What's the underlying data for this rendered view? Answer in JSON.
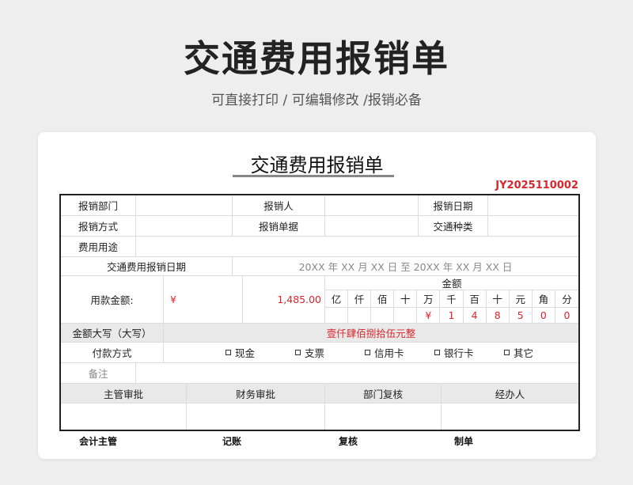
{
  "header": {
    "title": "交通费用报销单",
    "subtitle": "可直接打印 /  可编辑修改  /报销必备"
  },
  "form": {
    "title": "交通费用报销单",
    "doc_no": "JY2025110002",
    "labels": {
      "dept": "报销部门",
      "applicant": "报销人",
      "date": "报销日期",
      "method": "报销方式",
      "receipt": "报销单据",
      "transport_type": "交通种类",
      "purpose": "费用用途",
      "period": "交通费用报销日期",
      "amount": "用款金额:",
      "amount_header": "金额",
      "amount_upper": "金额大写（大写）",
      "pay_method": "付款方式",
      "note": "备注"
    },
    "period_text": "20XX  年  XX  月  XX  日    至    20XX  年  XX  月  XX  日",
    "currency": "¥",
    "amount_value": "1,485.00",
    "digit_units": [
      "亿",
      "仟",
      "佰",
      "十",
      "万",
      "千",
      "百",
      "十",
      "元",
      "角",
      "分"
    ],
    "digit_values": [
      "",
      "",
      "",
      "",
      "¥",
      "1",
      "4",
      "8",
      "5",
      "0",
      "0"
    ],
    "amount_upper_value": "壹仟肆佰捌拾伍元整",
    "pay_options": [
      "现金",
      "支票",
      "信用卡",
      "银行卡",
      "其它"
    ],
    "approvals": [
      "主管审批",
      "财务审批",
      "部门复核",
      "经办人"
    ],
    "signatures": [
      "会计主管",
      "记账",
      "复核",
      "制单"
    ]
  },
  "colors": {
    "accent_red": "#d9262c",
    "grid_line": "#dcdcdc",
    "header_fill": "#e9e9e9"
  }
}
